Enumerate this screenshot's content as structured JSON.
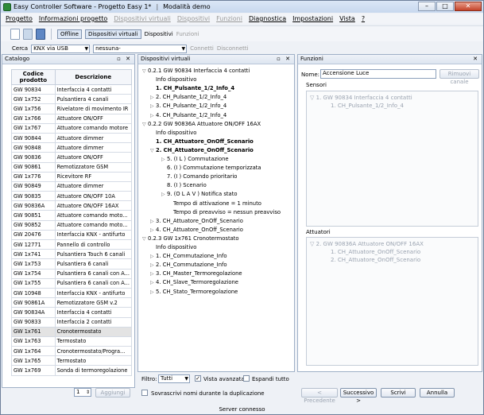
{
  "window": {
    "title": "Easy Controller Software - Progetto Easy 1*",
    "mode": "Modalità demo",
    "minimize": "–",
    "maximize": "□",
    "close": "✕"
  },
  "menu": [
    {
      "label": "Progetto",
      "disabled": false
    },
    {
      "label": "Informazioni progetto",
      "disabled": false
    },
    {
      "label": "Dispositivi virtuali",
      "disabled": true
    },
    {
      "label": "Dispositivi",
      "disabled": true
    },
    {
      "label": "Funzioni",
      "disabled": true
    },
    {
      "label": "Diagnostica",
      "disabled": false
    },
    {
      "label": "Impostazioni",
      "disabled": false
    },
    {
      "label": "Vista",
      "disabled": false
    },
    {
      "label": "?",
      "disabled": false
    }
  ],
  "toolbar": {
    "offline": "Offline",
    "virtual": "Dispositivi virtuali",
    "devices": "Dispositivi",
    "functions": "Funzioni"
  },
  "conn": {
    "search_label": "Cerca",
    "interface": "KNX via USB",
    "device": "nessuna-",
    "connect": "Connetti",
    "disconnect": "Disconnetti"
  },
  "catalog": {
    "title": "Catalogo",
    "col_code": "Codice prodotto",
    "col_desc": "Descrizione",
    "rows": [
      [
        "GW 90834",
        "Interfaccia 4 contatti"
      ],
      [
        "GW 1x752",
        "Pulsantiera 4 canali"
      ],
      [
        "GW 1x756",
        "Rivelatore di movimento IR"
      ],
      [
        "GW 1x766",
        "Attuatore ON/OFF"
      ],
      [
        "GW 1x767",
        "Attuatore comando motore"
      ],
      [
        "GW 90844",
        "Attuatore dimmer"
      ],
      [
        "GW 90848",
        "Attuatore dimmer"
      ],
      [
        "GW 90836",
        "Attuatore ON/OFF"
      ],
      [
        "GW 90861",
        "Remotizzatore GSM"
      ],
      [
        "GW 1x776",
        "Ricevitore RF"
      ],
      [
        "GW 90849",
        "Attuatore dimmer"
      ],
      [
        "GW 90835",
        "Attuatore ON/OFF 10A"
      ],
      [
        "GW 90836A",
        "Attuatore ON/OFF 16AX"
      ],
      [
        "GW 90851",
        "Attuatore comando moto..."
      ],
      [
        "GW 90852",
        "Attuatore comando moto..."
      ],
      [
        "GW 20476",
        "Interfaccia KNX - antifurto"
      ],
      [
        "GW 12771",
        "Pannello di controllo"
      ],
      [
        "GW 1x741",
        "Pulsantiera Touch 6 canali"
      ],
      [
        "GW 1x753",
        "Pulsantiera 6 canali"
      ],
      [
        "GW 1x754",
        "Pulsantiera 6 canali con A..."
      ],
      [
        "GW 1x755",
        "Pulsantiera 6 canali con A..."
      ],
      [
        "GW 10948",
        "Interfaccia KNX - antifurto"
      ],
      [
        "GW 90861A",
        "Remotizzatore GSM v.2"
      ],
      [
        "GW 90834A",
        "Interfaccia 4 contatti"
      ],
      [
        "GW 90833",
        "Interfaccia 2 contatti"
      ],
      [
        "GW 1x761",
        "Cronotermostato"
      ],
      [
        "GW 1x763",
        "Termostato"
      ],
      [
        "GW 1x764",
        "Cronotermostato/Progra..."
      ],
      [
        "GW 1x765",
        "Termostato"
      ],
      [
        "GW 1x769",
        "Sonda di termoregolazione"
      ]
    ],
    "selected_index": 25,
    "quantity": "1",
    "add": "Aggiungi"
  },
  "virtual": {
    "title": "Dispositivi virtuali",
    "nodes": [
      {
        "x": 0,
        "tri": "▽",
        "text": "0.2.1  GW 90834 Interfaccia 4 contatti",
        "b": false
      },
      {
        "x": 10,
        "tri": "",
        "text": "Info dispositivo",
        "b": false
      },
      {
        "x": 10,
        "tri": "",
        "text": "1. CH_Pulsante_1/2_Info_4",
        "b": true
      },
      {
        "x": 10,
        "tri": "▷",
        "text": "2. CH_Pulsante_1/2_Info_4",
        "b": false
      },
      {
        "x": 10,
        "tri": "▷",
        "text": "3. CH_Pulsante_1/2_Info_4",
        "b": false
      },
      {
        "x": 10,
        "tri": "▷",
        "text": "4. CH_Pulsante_1/2_Info_4",
        "b": false
      },
      {
        "x": 0,
        "tri": "▽",
        "text": "0.2.2  GW 90836A Attuatore ON/OFF 16AX",
        "b": false
      },
      {
        "x": 10,
        "tri": "",
        "text": "Info dispositivo",
        "b": false
      },
      {
        "x": 10,
        "tri": "",
        "text": "1. CH_Attuatore_OnOff_Scenario",
        "b": true
      },
      {
        "x": 10,
        "tri": "▽",
        "text": "2. CH_Attuatore_OnOff_Scenario",
        "b": true
      },
      {
        "x": 24,
        "tri": "▷",
        "text": "5. (I L )  Commutazione",
        "b": false
      },
      {
        "x": 24,
        "tri": "",
        "text": "6. (I )  Commutazione temporizzata",
        "b": false
      },
      {
        "x": 24,
        "tri": "",
        "text": "7. (I )  Comando prioritario",
        "b": false
      },
      {
        "x": 24,
        "tri": "",
        "text": "8. (I )  Scenario",
        "b": false
      },
      {
        "x": 24,
        "tri": "▷",
        "text": "9. (O L A V )  Notifica stato",
        "b": false
      },
      {
        "x": 32,
        "tri": "",
        "text": "Tempo di attivazione = 1 minuto",
        "b": false
      },
      {
        "x": 32,
        "tri": "",
        "text": "Tempo di preavviso = nessun preavviso",
        "b": false
      },
      {
        "x": 10,
        "tri": "▷",
        "text": "3. CH_Attuatore_OnOff_Scenario",
        "b": false
      },
      {
        "x": 10,
        "tri": "▷",
        "text": "4. CH_Attuatore_OnOff_Scenario",
        "b": false
      },
      {
        "x": 0,
        "tri": "▽",
        "text": "0.2.3  GW 1x761 Cronotermostato",
        "b": false
      },
      {
        "x": 10,
        "tri": "",
        "text": "Info dispositivo",
        "b": false
      },
      {
        "x": 10,
        "tri": "▷",
        "text": "1. CH_Commutazione_Info",
        "b": false
      },
      {
        "x": 10,
        "tri": "▷",
        "text": "2. CH_Commutazione_Info",
        "b": false
      },
      {
        "x": 10,
        "tri": "▷",
        "text": "3. CH_Master_Termoregolazione",
        "b": false
      },
      {
        "x": 10,
        "tri": "▷",
        "text": "4. CH_Slave_Termoregolazione",
        "b": false
      },
      {
        "x": 10,
        "tri": "▷",
        "text": "5. CH_Stato_Termoregolazione",
        "b": false
      }
    ],
    "filter_label": "Filtro:",
    "filter_value": "Tutti",
    "advanced_view": "Vista avanzata",
    "expand_all": "Espandi tutto",
    "overwrite": "Sovrascrivi nomi durante la duplicazione"
  },
  "functions": {
    "title": "Funzioni",
    "name_label": "Nome:",
    "name_value": "Accensione Luce",
    "remove_channel": "Rimuovi canale",
    "sensors_label": "Sensori",
    "sensors": [
      "1.  GW 90834 Interfaccia 4 contatti",
      "1. CH_Pulsante_1/2_Info_4"
    ],
    "actuators_label": "Attuatori",
    "actuators": [
      "2.  GW 90836A Attuatore ON/OFF 16AX",
      "1. CH_Attuatore_OnOff_Scenario",
      "2. CH_Attuatore_OnOff_Scenario"
    ],
    "prev": "< Precedente",
    "next": "Successivo >",
    "write": "Scrivi",
    "cancel": "Annulla"
  },
  "status": "Server connesso"
}
